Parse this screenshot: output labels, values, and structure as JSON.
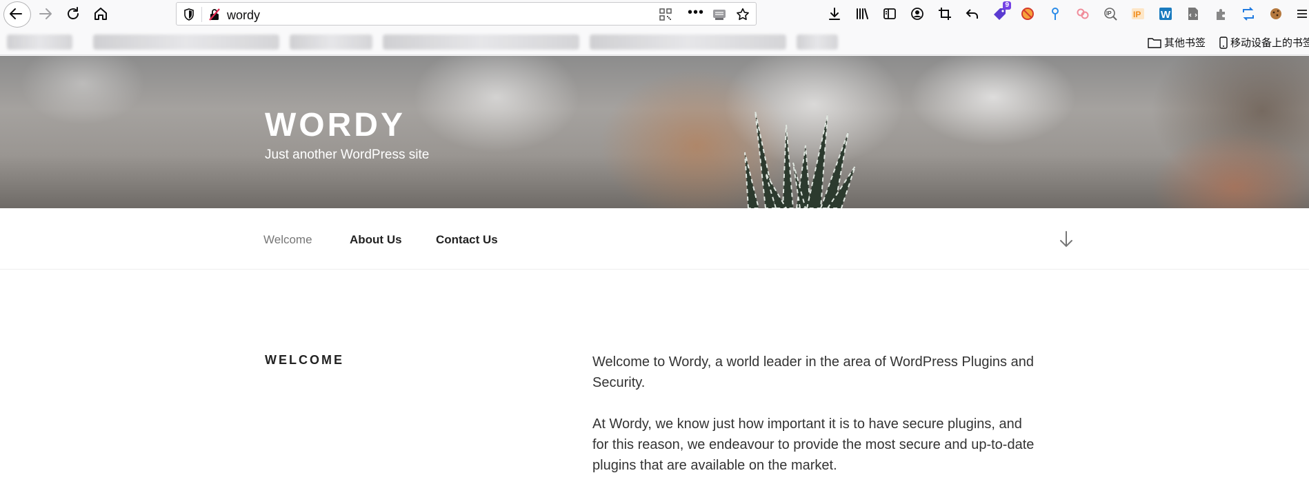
{
  "browser": {
    "url": "wordy",
    "extension_badge_count": "9",
    "bookmarks": [
      {
        "label": "其他书签"
      },
      {
        "label": "移动设备上的书签"
      }
    ]
  },
  "site": {
    "title": "WORDY",
    "tagline": "Just another WordPress site"
  },
  "nav": {
    "items": [
      {
        "label": "Welcome",
        "current": true
      },
      {
        "label": "About Us",
        "current": false
      },
      {
        "label": "Contact Us",
        "current": false
      }
    ]
  },
  "page": {
    "title": "WELCOME",
    "paragraphs": [
      "Welcome to Wordy, a world leader in the area of WordPress Plugins and Security.",
      "At Wordy, we know just how important it is to have secure plugins, and for this reason, we endeavour to provide the most secure and up-to-date plugins that are available on the market."
    ]
  },
  "colors": {
    "nav_current": "#767676",
    "text": "#222222",
    "badge": "#7542e5"
  }
}
